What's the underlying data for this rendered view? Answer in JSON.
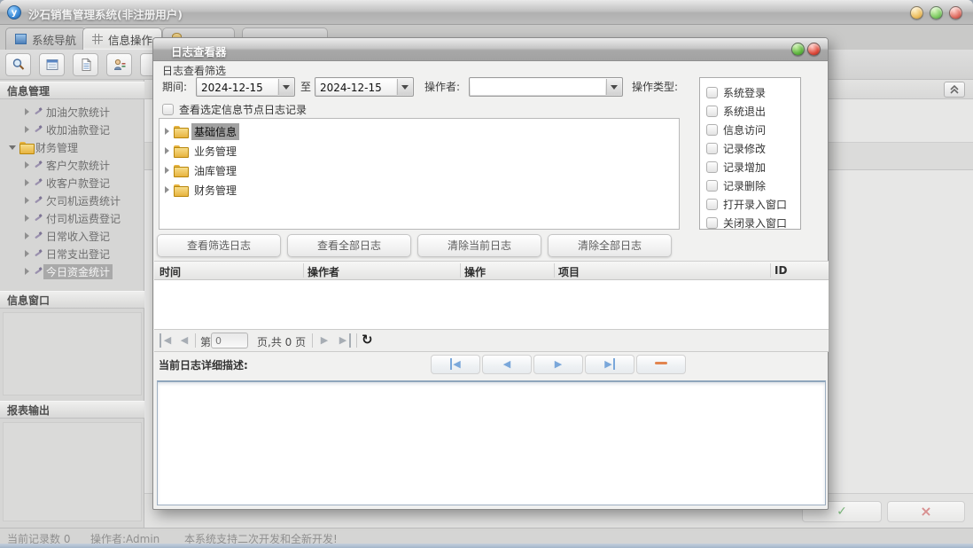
{
  "window": {
    "title": "沙石销售管理系统(非注册用户)",
    "logo_text": "y"
  },
  "tabs": {
    "system_nav": "系统导航",
    "info_ops": "信息操作"
  },
  "sidebar": {
    "section_info_mgmt": "信息管理",
    "section_info_window": "信息窗口",
    "section_report_output": "报表输出",
    "tree": [
      {
        "label": "加油欠款统计",
        "selected": false
      },
      {
        "label": "收加油款登记",
        "selected": false
      },
      {
        "label": "财务管理",
        "selected": false
      },
      {
        "label": "客户欠款统计",
        "selected": false
      },
      {
        "label": "收客户款登记",
        "selected": false
      },
      {
        "label": "欠司机运费统计",
        "selected": false
      },
      {
        "label": "付司机运费登记",
        "selected": false
      },
      {
        "label": "日常收入登记",
        "selected": false
      },
      {
        "label": "日常支出登记",
        "selected": false
      },
      {
        "label": "今日资金统计",
        "selected": true
      }
    ]
  },
  "dialog": {
    "title": "日志查看器",
    "filter_group_label": "日志查看筛选",
    "period_label": "期间:",
    "date_from": "2024-12-15",
    "to_label": "至",
    "date_to": "2024-12-15",
    "operator_label": "操作者:",
    "operator_value": "",
    "operation_type_label": "操作类型:",
    "operation_types": [
      "系统登录",
      "系统退出",
      "信息访问",
      "记录修改",
      "记录增加",
      "记录删除",
      "打开录入窗口",
      "关闭录入窗口"
    ],
    "node_filter_checkbox": "查看选定信息节点日志记录",
    "category_tree": [
      {
        "label": "基础信息",
        "selected": true
      },
      {
        "label": "业务管理",
        "selected": false
      },
      {
        "label": "油库管理",
        "selected": false
      },
      {
        "label": "财务管理",
        "selected": false
      }
    ],
    "action_buttons": [
      "查看筛选日志",
      "查看全部日志",
      "清除当前日志",
      "清除全部日志"
    ],
    "table_headers": [
      "时间",
      "操作者",
      "操作",
      "项目",
      "ID"
    ],
    "pagination": {
      "page_prefix": "第",
      "page_value": "0",
      "page_suffix": "页,共 0 页"
    },
    "detail_label": "当前日志详细描述:",
    "detail_text": ""
  },
  "statusbar": {
    "record_count": "当前记录数 0",
    "operator": "操作者:Admin",
    "message": "本系统支持二次开发和全新开发!"
  },
  "glyphs": {
    "arrow_left": "◀",
    "arrow_right": "▶",
    "refresh": "↻",
    "check": "✓",
    "cross": "×"
  },
  "colors": {
    "nav_arrow_blue": "#7aa7da",
    "minus_orange": "#e2854f",
    "confirm_green": "#7cb87c",
    "cancel_red": "#d89090",
    "dialog_close_red": "#a81e12",
    "dialog_min_green": "#2f8a22"
  }
}
